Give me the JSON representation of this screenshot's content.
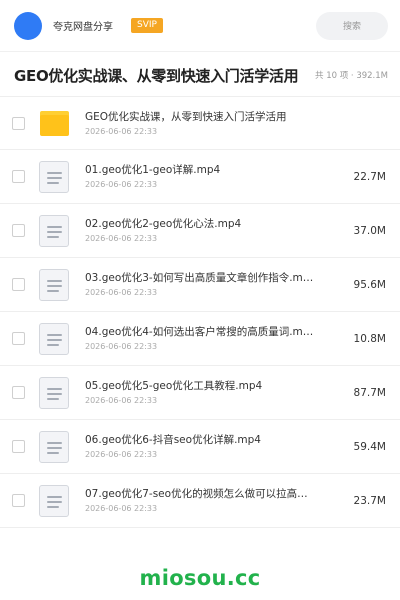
{
  "topbar": {
    "user_name": "夸克网盘分享",
    "badge": "SVIP",
    "search_label": "搜索",
    "avatar_color": "#2f7bf5"
  },
  "header": {
    "title": "GEO优化实战课、从零到快速入门活学活用",
    "summary": "共 10 项 · 392.1M"
  },
  "files": [
    {
      "name": "GEO优化实战课，从零到快速入门活学活用",
      "date": "2026-06-06 22:33",
      "size": "",
      "icon": "folder-icon"
    },
    {
      "name": "01.geo优化1-geo详解.mp4",
      "date": "2026-06-06 22:33",
      "size": "22.7M",
      "icon": "file-icon"
    },
    {
      "name": "02.geo优化2-geo优化心法.mp4",
      "date": "2026-06-06 22:33",
      "size": "37.0M",
      "icon": "file-icon"
    },
    {
      "name": "03.geo优化3-如何写出高质量文章创作指令.m…",
      "date": "2026-06-06 22:33",
      "size": "95.6M",
      "icon": "file-icon"
    },
    {
      "name": "04.geo优化4-如何选出客户常搜的高质量词.m…",
      "date": "2026-06-06 22:33",
      "size": "10.8M",
      "icon": "file-icon"
    },
    {
      "name": "05.geo优化5-geo优化工具教程.mp4",
      "date": "2026-06-06 22:33",
      "size": "87.7M",
      "icon": "file-icon"
    },
    {
      "name": "06.geo优化6-抖音seo优化详解.mp4",
      "date": "2026-06-06 22:33",
      "size": "59.4M",
      "icon": "file-icon"
    },
    {
      "name": "07.geo优化7-seo优化的视频怎么做可以拉高…",
      "date": "2026-06-06 22:33",
      "size": "23.7M",
      "icon": "file-icon"
    }
  ],
  "footer": {
    "watermark": "miosou.cc",
    "watermark_color": "#22b24c"
  }
}
